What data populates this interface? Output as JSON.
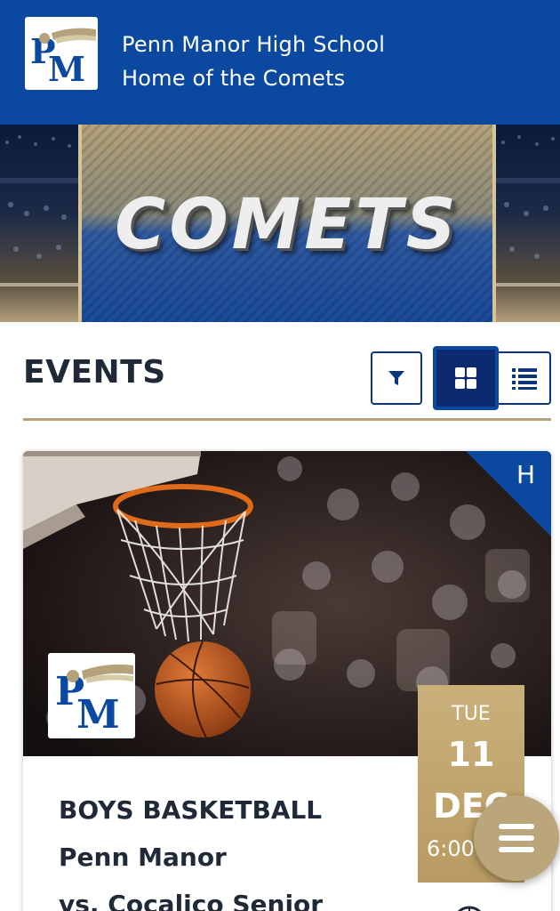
{
  "header": {
    "school_name": "Penn Manor High School",
    "tagline": "Home of the Comets",
    "logo_text": "PM",
    "background_color": "#0b48a0"
  },
  "hero": {
    "banner_text": "COMETS",
    "accent_gold": "#b5a27a",
    "accent_blue": "#0b48a0"
  },
  "events": {
    "title": "EVENTS",
    "filter_icon": "filter-icon",
    "grid_view_icon": "grid-view-icon",
    "list_view_icon": "list-view-icon",
    "active_view": "grid"
  },
  "event_card": {
    "home_away": "H",
    "logo_text": "PM",
    "date": {
      "day_of_week": "TUE",
      "day": "11",
      "month": "DEC",
      "time": "6:00"
    },
    "sport": "BOYS BASKETBALL",
    "team_home": "Penn Manor",
    "matchup": "vs. Cocalico Senior"
  },
  "fab": {
    "icon": "menu-icon"
  }
}
